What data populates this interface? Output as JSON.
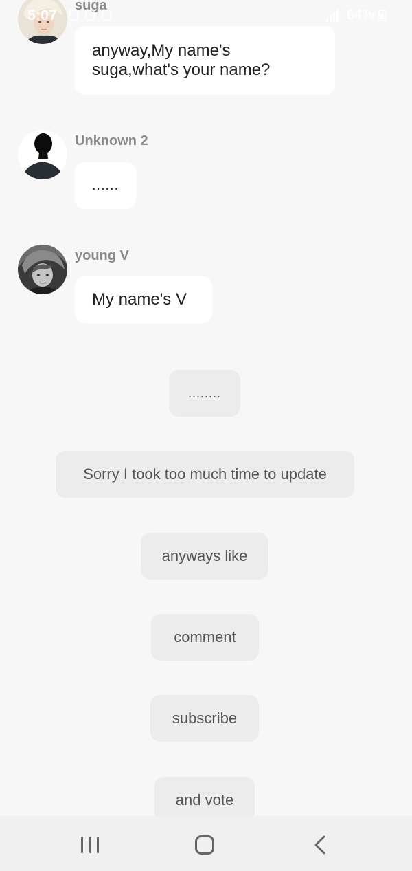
{
  "status_bar": {
    "time": "5:07",
    "battery": "64%"
  },
  "messages": [
    {
      "sender": "suga",
      "text_lines": [
        "anyway,My name's",
        "suga,what's your name?"
      ]
    },
    {
      "sender": "Unknown 2",
      "text": "......"
    },
    {
      "sender": "young V",
      "text": "My name's V"
    }
  ],
  "narration": [
    "........",
    "Sorry I took too much time to update",
    "anyways like",
    "comment",
    "subscribe",
    "and vote"
  ],
  "nav_icons": [
    "recents-icon",
    "home-icon",
    "back-icon"
  ]
}
